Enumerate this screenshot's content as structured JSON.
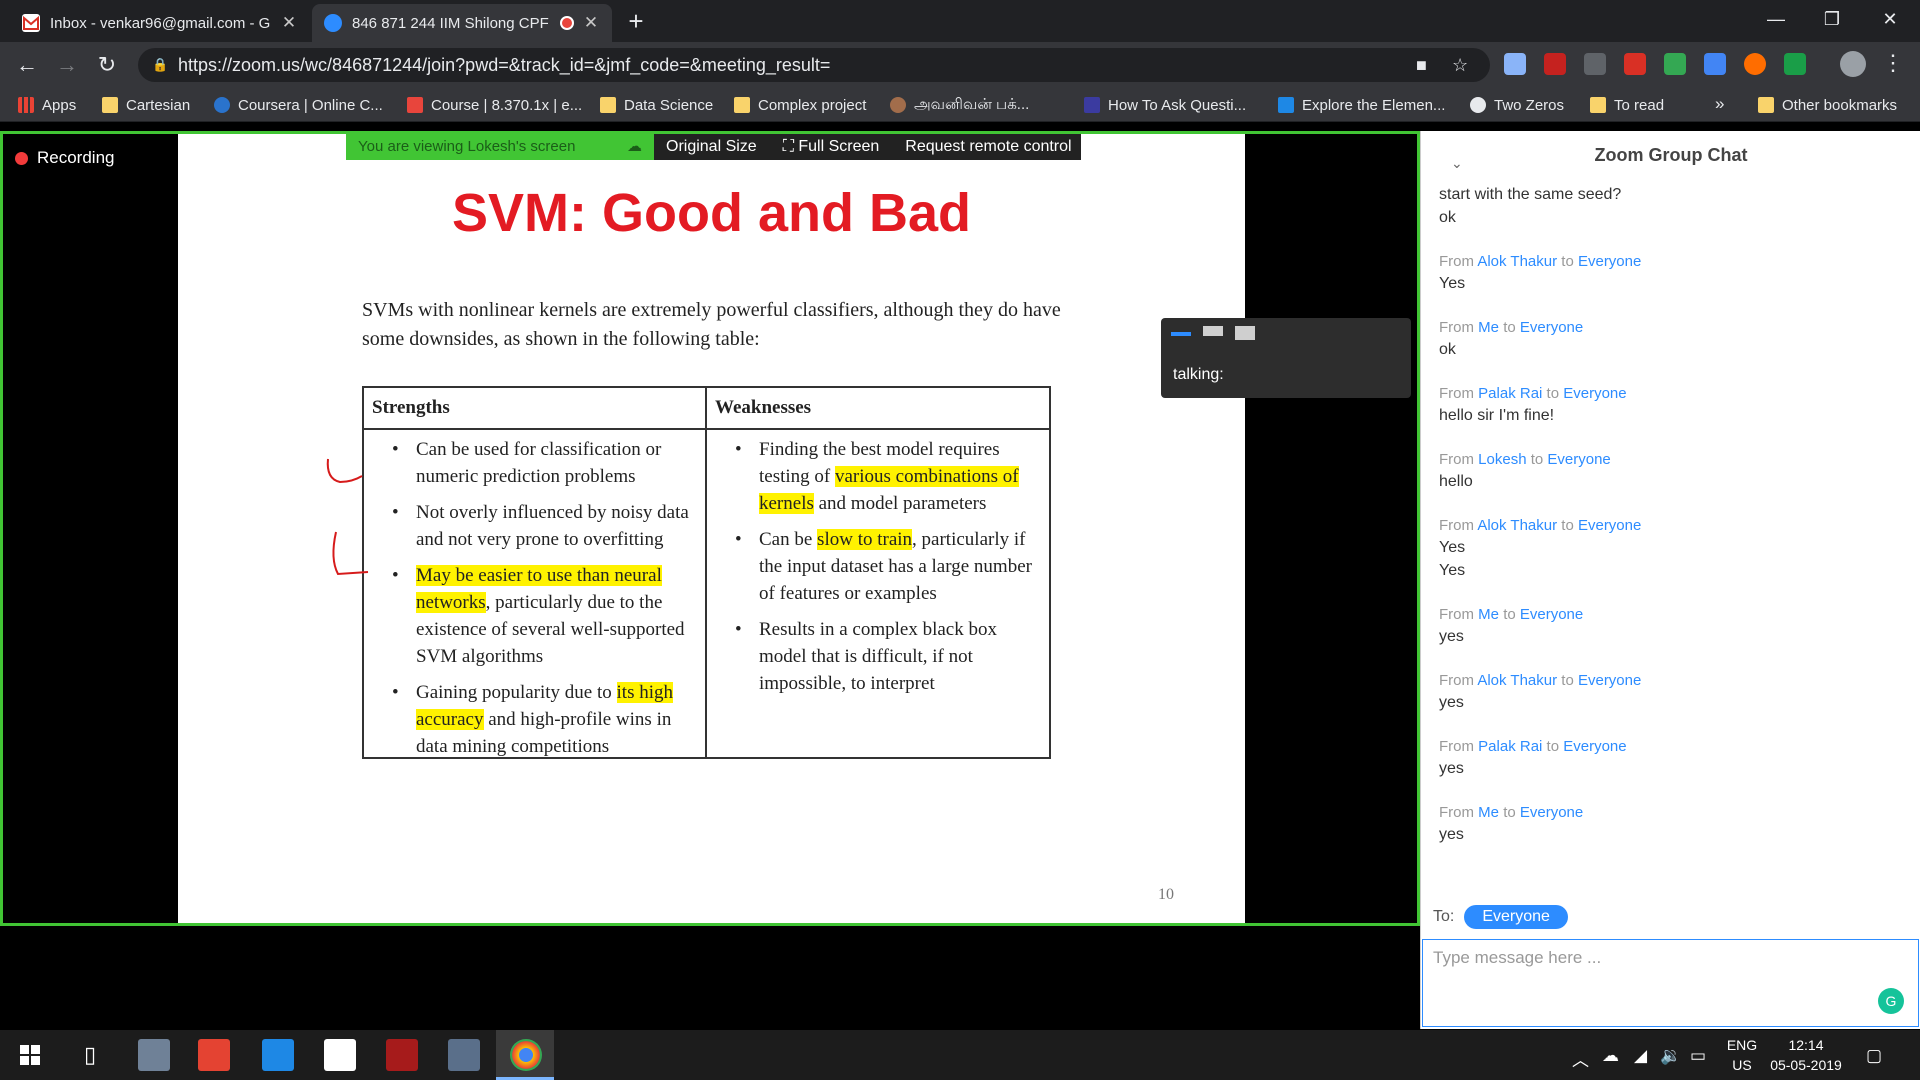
{
  "browser": {
    "tabs": [
      {
        "title": "Inbox - venkar96@gmail.com - G",
        "icon": "gmail-icon",
        "active": false
      },
      {
        "title": "846 871 244 IIM Shilong CPF",
        "icon": "zoom-icon",
        "active": true
      }
    ],
    "url": "https://zoom.us/wc/846871244/join?pwd=&track_id=&jmf_code=&meeting_result=",
    "bookmarks": [
      "Apps",
      "Cartesian",
      "Coursera | Online C...",
      "Course | 8.370.1x | e...",
      "Data Science",
      "Complex project",
      "அவனிவன் பக்...",
      "How To Ask Questi...",
      "Explore the Elemen...",
      "Two Zeros",
      "To read"
    ],
    "other_bookmarks": "Other bookmarks"
  },
  "zoom": {
    "recording_label": "Recording",
    "viewing_label": "You are viewing Lokesh's screen",
    "original_size": "Original Size",
    "full_screen": "Full Screen",
    "remote_control": "Request remote control",
    "talking_label": "talking:"
  },
  "slide": {
    "title": "SVM: Good and Bad",
    "intro": "SVMs with nonlinear kernels are extremely powerful classifiers, although they do have some downsides, as shown in the following table:",
    "strengths_header": "Strengths",
    "weaknesses_header": "Weaknesses",
    "strengths": [
      {
        "plain_a": "Can be used for classification or numeric prediction problems",
        "hl": "",
        "plain_b": ""
      },
      {
        "plain_a": "Not overly influenced by noisy data and not very prone to overfitting",
        "hl": "",
        "plain_b": ""
      },
      {
        "plain_a": "",
        "hl": "May be easier to use than neural networks",
        "plain_b": ", particularly due to the existence of several well-supported SVM algorithms"
      },
      {
        "plain_a": "Gaining popularity due to ",
        "hl": "its high accuracy",
        "plain_b": " and high-profile wins in data mining competitions"
      }
    ],
    "weaknesses": [
      {
        "plain_a": "Finding the best model requires testing of ",
        "hl": "various combinations of kernels",
        "plain_b": " and model parameters"
      },
      {
        "plain_a": "Can be ",
        "hl": "slow to train",
        "plain_b": ", particularly if the input dataset has a large number of features or examples"
      },
      {
        "plain_a": "Results in a complex black box model that is difficult, if not impossible, to interpret",
        "hl": "",
        "plain_b": ""
      }
    ],
    "page_number": "10"
  },
  "chat": {
    "title": "Zoom Group Chat",
    "messages": [
      {
        "from": "",
        "to": "",
        "lines": [
          "start with the same seed?",
          "ok"
        ]
      },
      {
        "from": "Alok Thakur",
        "to": "Everyone",
        "lines": [
          "Yes"
        ]
      },
      {
        "from": "Me",
        "to": "Everyone",
        "lines": [
          "ok"
        ]
      },
      {
        "from": "Palak Rai",
        "to": "Everyone",
        "lines": [
          "hello sir I'm fine!"
        ]
      },
      {
        "from": "Lokesh",
        "to": "Everyone",
        "lines": [
          "hello"
        ]
      },
      {
        "from": "Alok Thakur",
        "to": "Everyone",
        "lines": [
          "Yes",
          "Yes"
        ]
      },
      {
        "from": "Me",
        "to": "Everyone",
        "lines": [
          "yes"
        ]
      },
      {
        "from": "Alok Thakur",
        "to": "Everyone",
        "lines": [
          "yes"
        ]
      },
      {
        "from": "Palak Rai",
        "to": "Everyone",
        "lines": [
          "yes"
        ]
      },
      {
        "from": "Me",
        "to": "Everyone",
        "lines": [
          "yes"
        ]
      }
    ],
    "from_word": "From",
    "to_word": "to",
    "to_label": "To:",
    "recipient": "Everyone",
    "input_placeholder": "Type message here ..."
  },
  "taskbar": {
    "lang": "ENG",
    "region": "US",
    "time": "12:14",
    "date": "05-05-2019"
  }
}
